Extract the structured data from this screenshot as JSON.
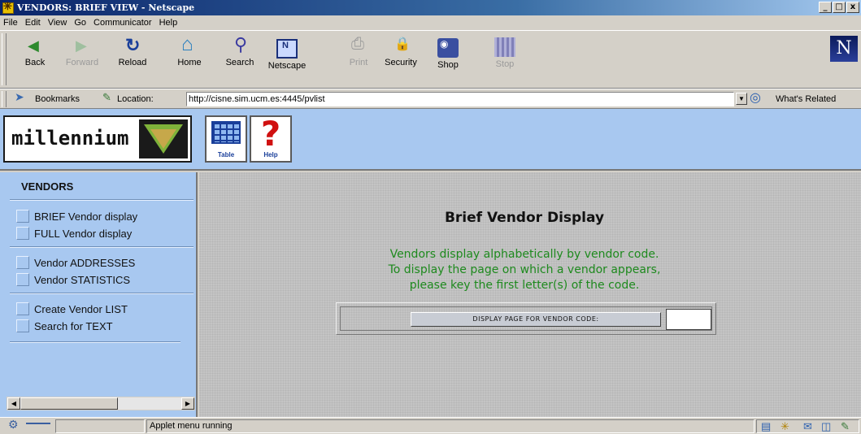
{
  "window": {
    "title": "VENDORS: BRIEF VIEW - Netscape",
    "controls": [
      "_",
      "□",
      "x"
    ]
  },
  "menu": [
    "File",
    "Edit",
    "View",
    "Go",
    "Communicator",
    "Help"
  ],
  "toolbar": {
    "buttons": [
      {
        "label": "Back",
        "icon": "back-arrow-icon",
        "enabled": true
      },
      {
        "label": "Forward",
        "icon": "forward-arrow-icon",
        "enabled": false
      },
      {
        "label": "Reload",
        "icon": "reload-icon",
        "enabled": true
      },
      {
        "label": "Home",
        "icon": "home-icon",
        "enabled": true
      },
      {
        "label": "Search",
        "icon": "search-icon",
        "enabled": true
      },
      {
        "label": "Netscape",
        "icon": "netscape-icon",
        "enabled": true
      },
      {
        "label": "Print",
        "icon": "print-icon",
        "enabled": false
      },
      {
        "label": "Security",
        "icon": "security-lock-icon",
        "enabled": true
      },
      {
        "label": "Shop",
        "icon": "shop-icon",
        "enabled": true
      },
      {
        "label": "Stop",
        "icon": "stop-icon",
        "enabled": false
      }
    ],
    "brand_letter": "N"
  },
  "location_bar": {
    "bookmarks_label": "Bookmarks",
    "location_label": "Location:",
    "url": "http://cisne.sim.ucm.es:4445/pvlist",
    "related_label": "What's Related"
  },
  "app": {
    "logo_text": "millennium",
    "tools": [
      {
        "label": "Table",
        "icon": "table-grid-icon"
      },
      {
        "label": "Help",
        "icon": "help-question-icon"
      }
    ],
    "nav": {
      "title": "VENDORS",
      "groups": [
        [
          "BRIEF Vendor display",
          "FULL Vendor display"
        ],
        [
          "Vendor ADDRESSES",
          "Vendor STATISTICS"
        ],
        [
          "Create Vendor LIST",
          "Search for TEXT"
        ]
      ]
    },
    "main": {
      "title": "Brief Vendor Display",
      "desc_lines": [
        "Vendors display alphabetically by vendor code.",
        "To display the page on which a vendor appears,",
        "please key the first letter(s) of the code."
      ],
      "button_label": "DISPLAY PAGE FOR VENDOR CODE:",
      "input_value": ""
    },
    "colors": {
      "frame_blue": "#a8c8f0",
      "desc_green": "#1e8a1e",
      "help_red": "#d01010"
    }
  },
  "status": {
    "text": "Applet menu running"
  }
}
